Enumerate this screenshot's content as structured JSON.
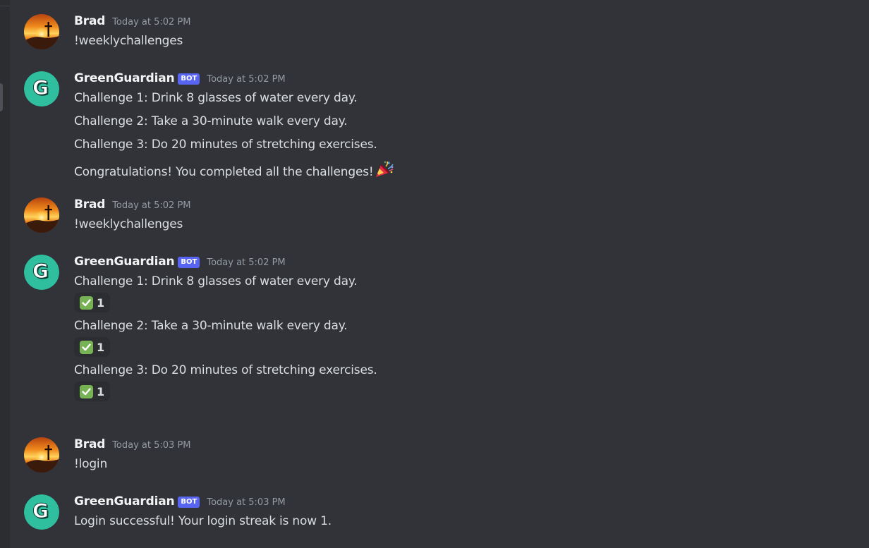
{
  "messages": [
    {
      "author": "Brad",
      "timestamp": "Today at 5:02 PM",
      "lines": [
        "!weeklychallenges"
      ]
    },
    {
      "author": "GreenGuardian",
      "bot_tag": "BOT",
      "timestamp": "Today at 5:02 PM",
      "lines": [
        "Challenge 1: Drink 8 glasses of water every day.",
        "Challenge 2: Take a 30-minute walk every day.",
        "Challenge 3: Do 20 minutes of stretching exercises.",
        "Congratulations! You completed all the challenges!"
      ],
      "emoji": "party-popper-icon"
    },
    {
      "author": "Brad",
      "timestamp": "Today at 5:02 PM",
      "lines": [
        "!weeklychallenges"
      ]
    },
    {
      "author": "GreenGuardian",
      "bot_tag": "BOT",
      "timestamp": "Today at 5:02 PM",
      "challenges": [
        {
          "text": "Challenge 1: Drink 8 glasses of water every day.",
          "reaction": {
            "emoji": "white-check-mark",
            "count": "1"
          }
        },
        {
          "text": "Challenge 2: Take a 30-minute walk every day.",
          "reaction": {
            "emoji": "white-check-mark",
            "count": "1"
          }
        },
        {
          "text": "Challenge 3: Do 20 minutes of stretching exercises.",
          "reaction": {
            "emoji": "white-check-mark",
            "count": "1"
          }
        }
      ]
    },
    {
      "author": "Brad",
      "timestamp": "Today at 5:03 PM",
      "lines": [
        "!login"
      ]
    },
    {
      "author": "GreenGuardian",
      "bot_tag": "BOT",
      "timestamp": "Today at 5:03 PM",
      "lines": [
        "Login successful! Your login streak is now 1."
      ]
    }
  ],
  "colors": {
    "background": "#313338",
    "bot_tag": "#5865f2",
    "bot_avatar": "#2fbf9f",
    "check": "#77b255"
  }
}
